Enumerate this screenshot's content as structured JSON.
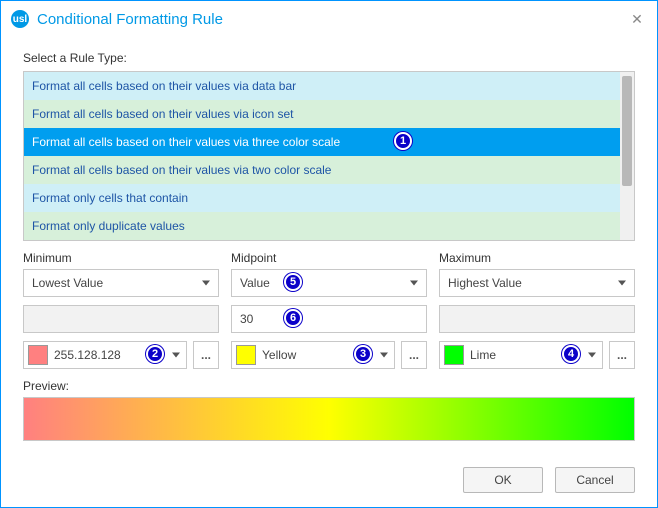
{
  "window": {
    "title": "Conditional Formatting Rule",
    "logo_text": "usl",
    "close_glyph": "✕"
  },
  "section": {
    "rule_type_label": "Select a Rule Type:",
    "preview_label": "Preview:"
  },
  "rule_list": {
    "items": [
      {
        "label": "Format all cells based on their values via data bar",
        "selected": false
      },
      {
        "label": "Format all cells based on their values via icon set",
        "selected": false
      },
      {
        "label": "Format all cells based on their values via three color scale",
        "selected": true
      },
      {
        "label": "Format all cells based on their values via two color scale",
        "selected": false
      },
      {
        "label": "Format only cells that contain",
        "selected": false
      },
      {
        "label": "Format only duplicate values",
        "selected": false
      }
    ]
  },
  "columns": {
    "min": {
      "header": "Minimum",
      "type_value": "Lowest Value",
      "value_input": "",
      "color_label": "255.128.128",
      "color_hex": "#ff8080"
    },
    "mid": {
      "header": "Midpoint",
      "type_value": "Value",
      "value_input": "30",
      "color_label": "Yellow",
      "color_hex": "#ffff00"
    },
    "max": {
      "header": "Maximum",
      "type_value": "Highest Value",
      "value_input": "",
      "color_label": "Lime",
      "color_hex": "#00ff00"
    }
  },
  "buttons": {
    "ok": "OK",
    "cancel": "Cancel",
    "more": "..."
  },
  "callouts": {
    "c1": "1",
    "c2": "2",
    "c3": "3",
    "c4": "4",
    "c5": "5",
    "c6": "6"
  }
}
